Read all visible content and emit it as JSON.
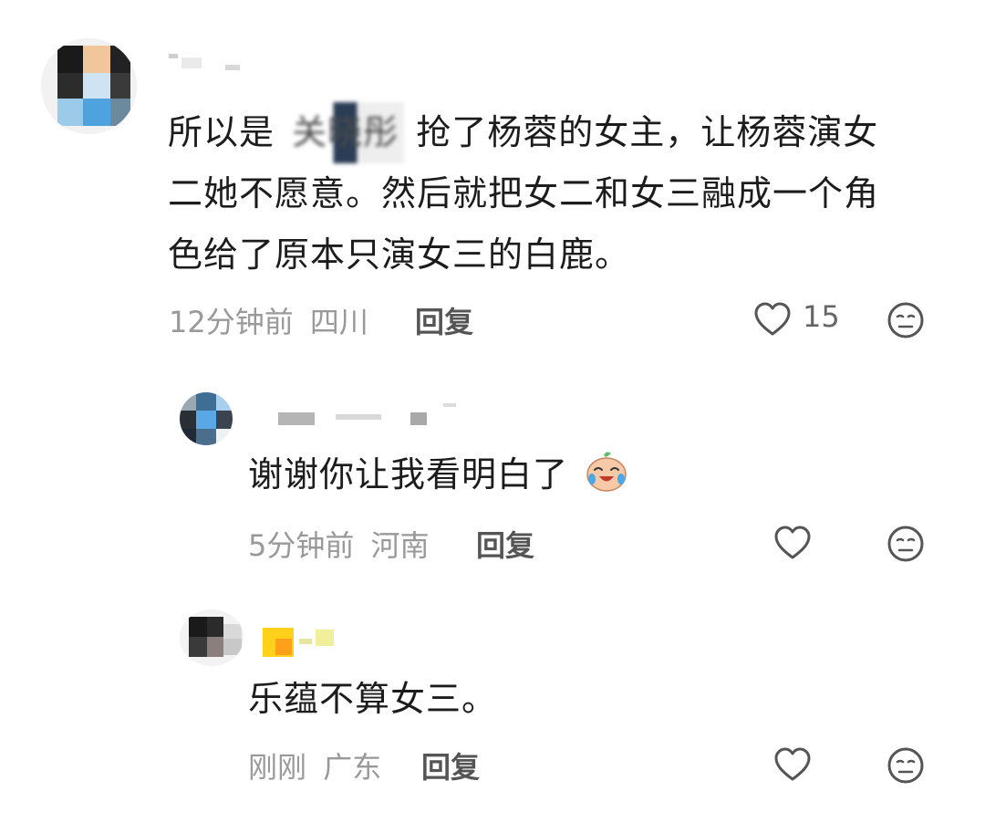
{
  "comments": [
    {
      "text_before": "所以是",
      "text_redacted": "关晓彤",
      "text_after": "抢了杨蓉的女主，让杨蓉演女",
      "text_line2": "二她不愿意。然后就把女二和女三融成一个角",
      "text_line3": "色给了原本只演女三的白鹿。",
      "time": "12分钟前",
      "location": "四川",
      "reply_label": "回复",
      "likes": "15",
      "icons": {
        "like": "heart-outline-icon",
        "dislike": "neutral-face-icon"
      }
    },
    {
      "text": "谢谢你让我看明白了",
      "emoji": "crying-laughing-sticker",
      "time": "5分钟前",
      "location": "河南",
      "reply_label": "回复",
      "icons": {
        "like": "heart-outline-icon",
        "dislike": "neutral-face-icon"
      }
    },
    {
      "text": "乐蕴不算女三。",
      "time": "刚刚",
      "location": "广东",
      "reply_label": "回复",
      "icons": {
        "like": "heart-outline-icon",
        "dislike": "neutral-face-icon"
      }
    }
  ],
  "colors": {
    "meta": "#999999",
    "reply": "#555555",
    "text": "#1c1c1c"
  }
}
